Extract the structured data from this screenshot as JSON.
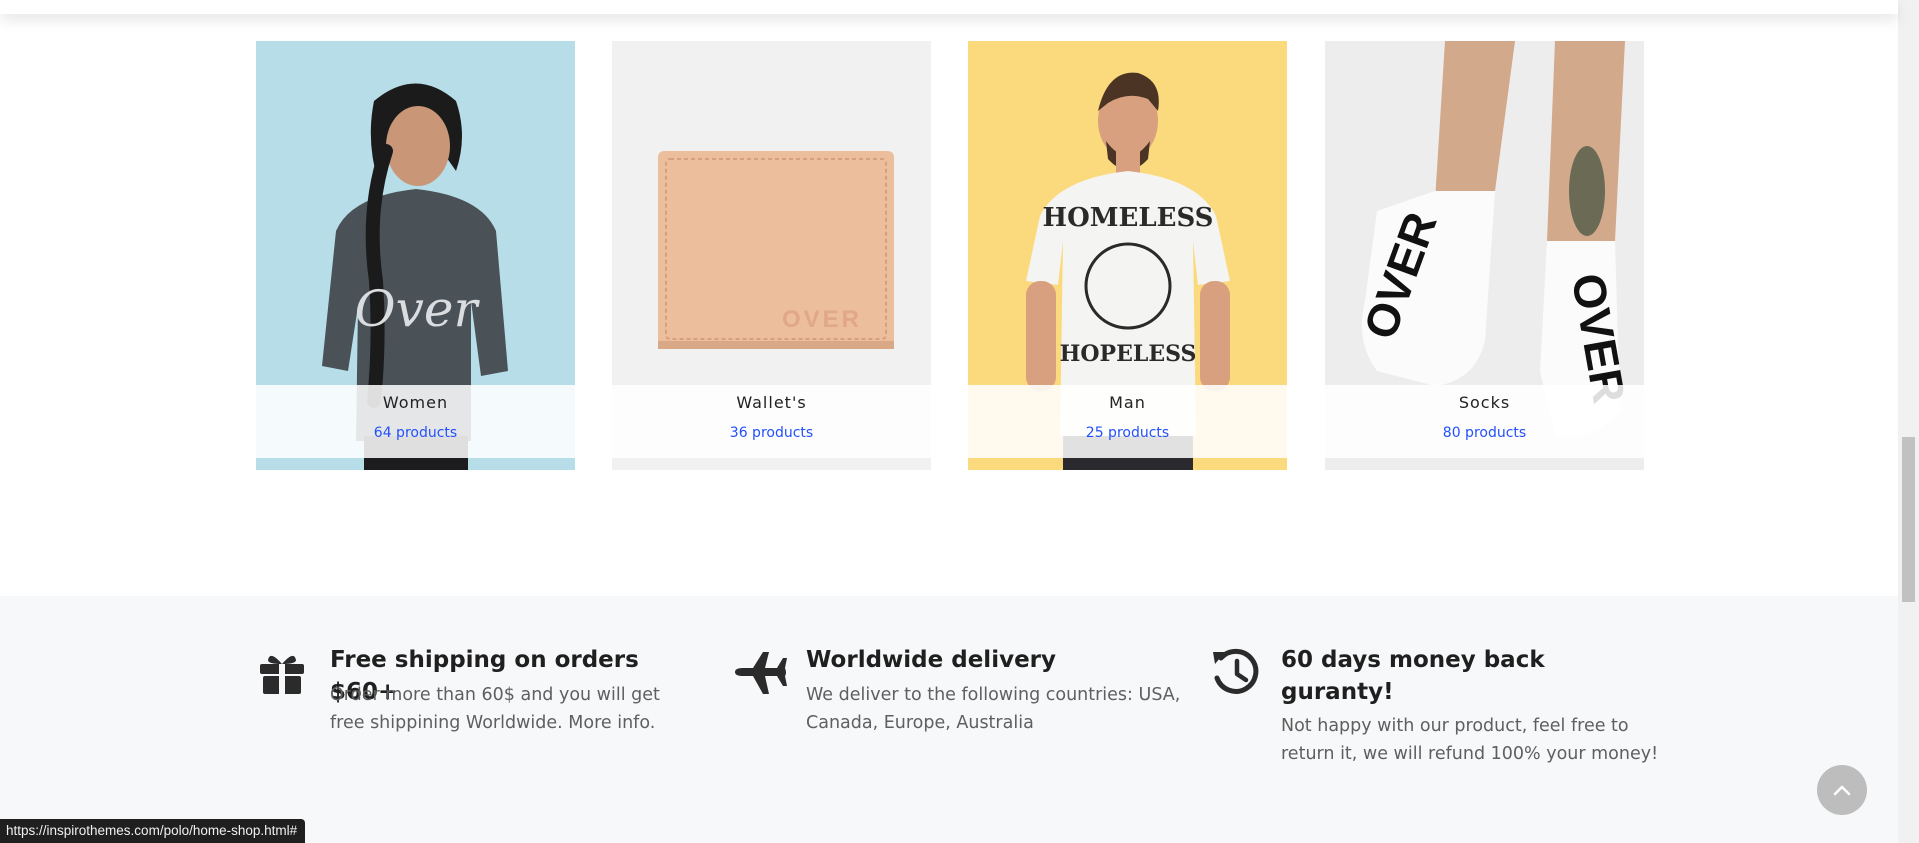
{
  "categories": [
    {
      "title": "Women",
      "count": "64 products",
      "bg": "#b7dee8"
    },
    {
      "title": "Wallet's",
      "count": "36 products",
      "bg": "#f1f1f2"
    },
    {
      "title": "Man",
      "count": "25 products",
      "bg": "#fbd97d"
    },
    {
      "title": "Socks",
      "count": "80 products",
      "bg": "#ededee"
    }
  ],
  "features": [
    {
      "icon": "gift-icon",
      "title": "Free shipping on orders $60+",
      "text_line1": "Order more than 60$ and you will get",
      "text_line2": "free shippining Worldwide. More info."
    },
    {
      "icon": "plane-icon",
      "title": "Worldwide delivery",
      "text_line1": "We deliver to the following countries: USA,",
      "text_line2": "Canada, Europe, Australia"
    },
    {
      "icon": "history-icon",
      "title_line1": "60 days money back",
      "title_line2": "guranty!",
      "text_line1": "Not happy with our product, feel free to",
      "text_line2": "return it, we will refund 100% your money!"
    }
  ],
  "status_url": "https://inspirothemes.com/polo/home-shop.html#",
  "colors": {
    "link": "#2250fc",
    "features_bg": "#f7f8f9",
    "back_to_top": "#bdbdbd"
  },
  "back_to_top_icon": "chevron-up-icon"
}
